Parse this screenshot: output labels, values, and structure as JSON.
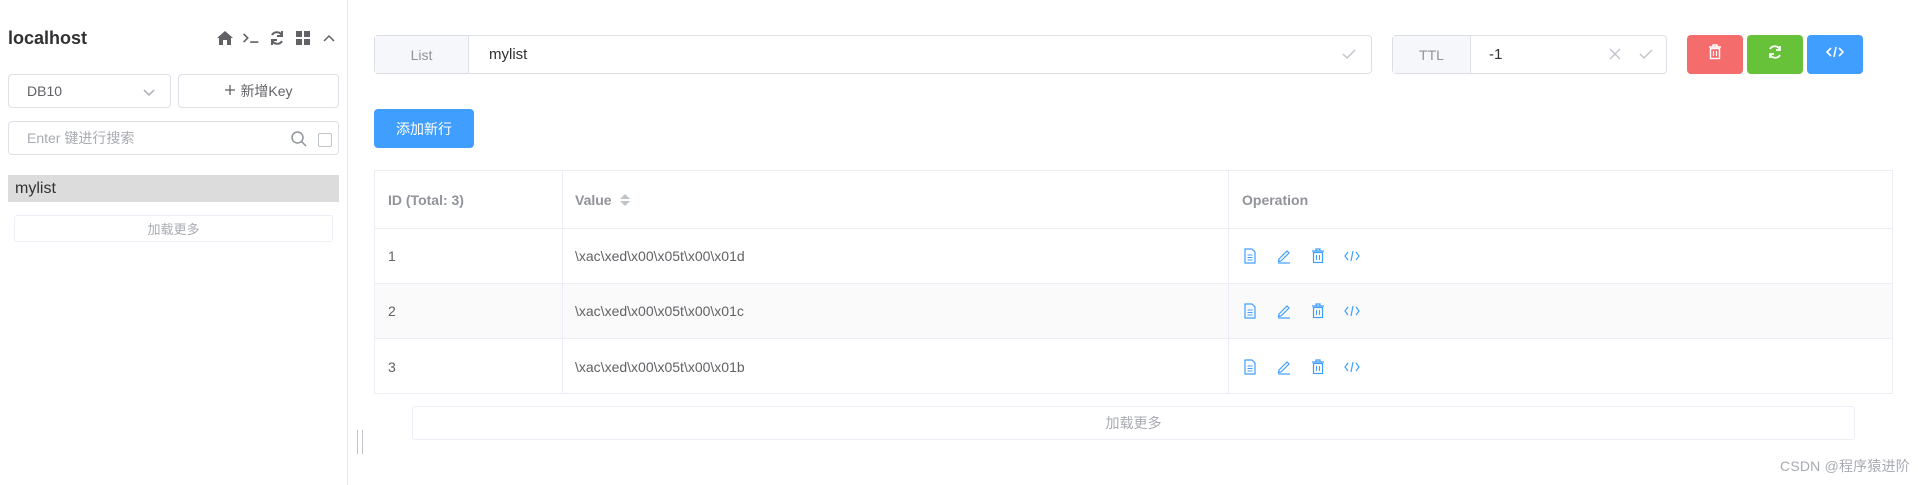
{
  "sidebar": {
    "connection_name": "localhost",
    "icons": [
      "home-icon",
      "terminal-icon",
      "refresh-icon",
      "grid-icon",
      "chevron-up-icon"
    ],
    "db_select": "DB10",
    "new_key_label": "新增Key",
    "search_placeholder": "Enter 键进行搜索",
    "keys": [
      {
        "label": "mylist"
      }
    ],
    "load_more": "加载更多"
  },
  "editor": {
    "type_label": "List",
    "key_name": "mylist",
    "ttl_label": "TTL",
    "ttl_value": "-1",
    "add_row_label": "添加新行",
    "colors": {
      "delete": "#f56c6c",
      "refresh": "#67c23a",
      "code": "#409eff",
      "primary": "#409eff"
    }
  },
  "table": {
    "headers": {
      "id": "ID (Total: 3)",
      "value": "Value",
      "operation": "Operation"
    },
    "rows": [
      {
        "id": "1",
        "value": "\\xac\\xed\\x00\\x05t\\x00\\x01d"
      },
      {
        "id": "2",
        "value": "\\xac\\xed\\x00\\x05t\\x00\\x01c"
      },
      {
        "id": "3",
        "value": "\\xac\\xed\\x00\\x05t\\x00\\x01b"
      }
    ],
    "row_ops": [
      "document-icon",
      "edit-icon",
      "delete-icon",
      "code-icon"
    ],
    "load_more": "加载更多"
  },
  "watermark": "CSDN @程序猿进阶"
}
